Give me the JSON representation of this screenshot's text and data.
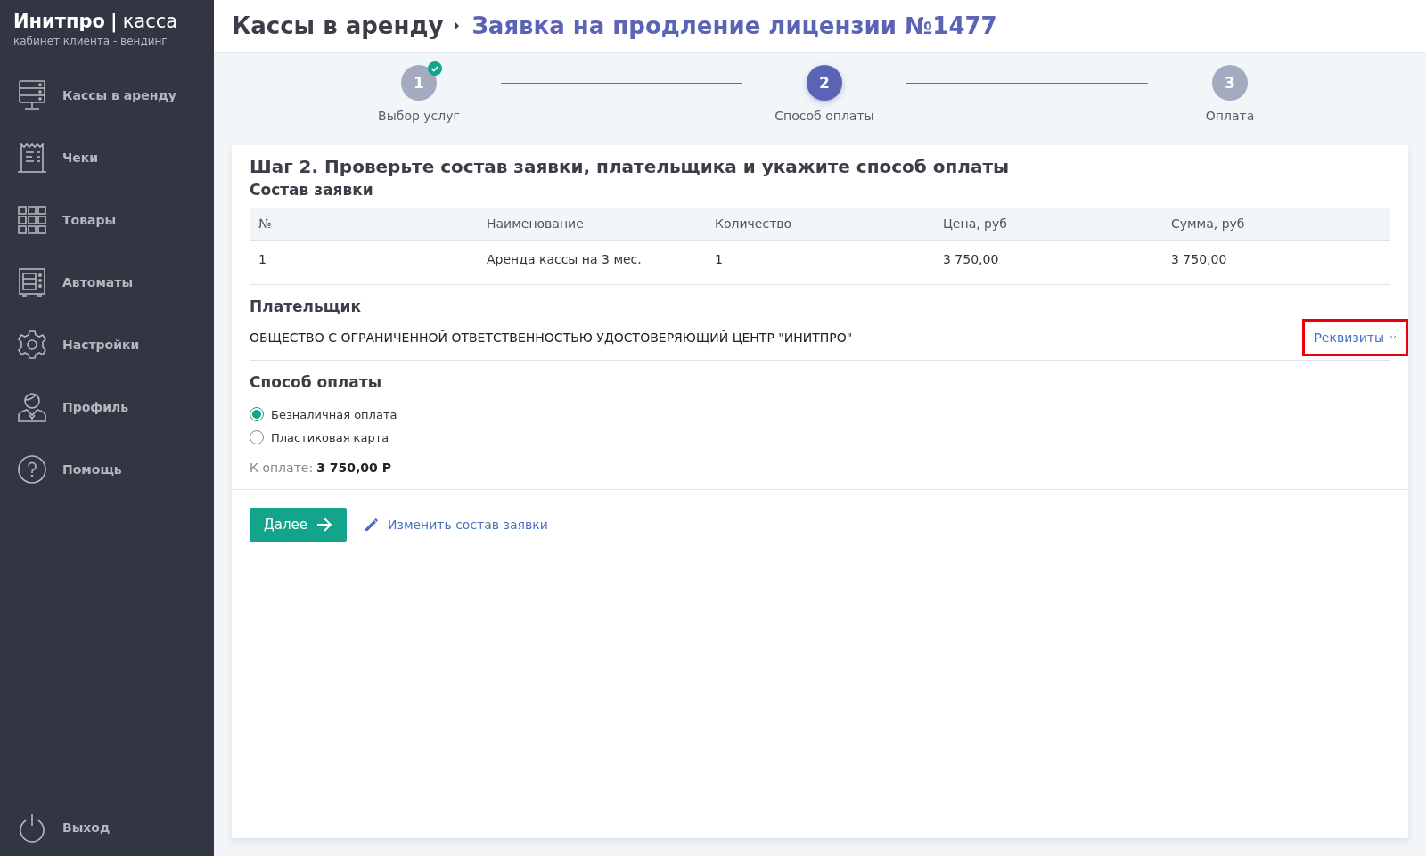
{
  "brand": {
    "name": "Инитпро",
    "separator": "|",
    "product": "касса",
    "subtitle": "кабинет клиента - вендинг"
  },
  "sidebar": {
    "items": [
      {
        "label": "Кассы в аренду",
        "kind": "register"
      },
      {
        "label": "Чеки",
        "kind": "receipt"
      },
      {
        "label": "Товары",
        "kind": "grid"
      },
      {
        "label": "Автоматы",
        "kind": "vending"
      },
      {
        "label": "Настройки",
        "kind": "gear"
      },
      {
        "label": "Профиль",
        "kind": "person"
      },
      {
        "label": "Помощь",
        "kind": "help"
      }
    ],
    "logout": {
      "label": "Выход"
    }
  },
  "breadcrumb": {
    "parent": "Кассы в аренду",
    "current": "Заявка на продление лицензии №1477"
  },
  "steps": [
    {
      "number": "1",
      "label": "Выбор услуг",
      "completed": true,
      "selected": false
    },
    {
      "number": "2",
      "label": "Способ оплаты",
      "completed": false,
      "selected": true
    },
    {
      "number": "3",
      "label": "Оплата",
      "completed": false,
      "selected": false
    }
  ],
  "card": {
    "title": "Шаг 2. Проверьте состав заявки, плательщика и укажите способ оплаты",
    "order_heading": "Состав заявки",
    "table": {
      "columns": [
        "№",
        "Наименование",
        "Количество",
        "Цена, руб",
        "Сумма, руб"
      ],
      "rows": [
        [
          "1",
          "Аренда кассы на 3 мес.",
          "1",
          "3 750,00",
          "3 750,00"
        ]
      ]
    },
    "payer_heading": "Плательщик",
    "payer": "ОБЩЕСТВО С ОГРАНИЧЕННОЙ ОТВЕТСТВЕННОСТЬЮ УДОСТОВЕРЯЮЩИЙ ЦЕНТР \"ИНИТПРО\"",
    "details_link": {
      "label": "Реквизиты",
      "highlighted": true
    },
    "payment_heading": "Способ оплаты",
    "payment_options": [
      {
        "label": "Безналичная оплата",
        "selected": true
      },
      {
        "label": "Пластиковая карта",
        "selected": false
      }
    ],
    "total_label": "К оплате:",
    "total_value": "3 750,00 Р",
    "next_button": "Далее",
    "edit_link": "Изменить состав заявки"
  }
}
